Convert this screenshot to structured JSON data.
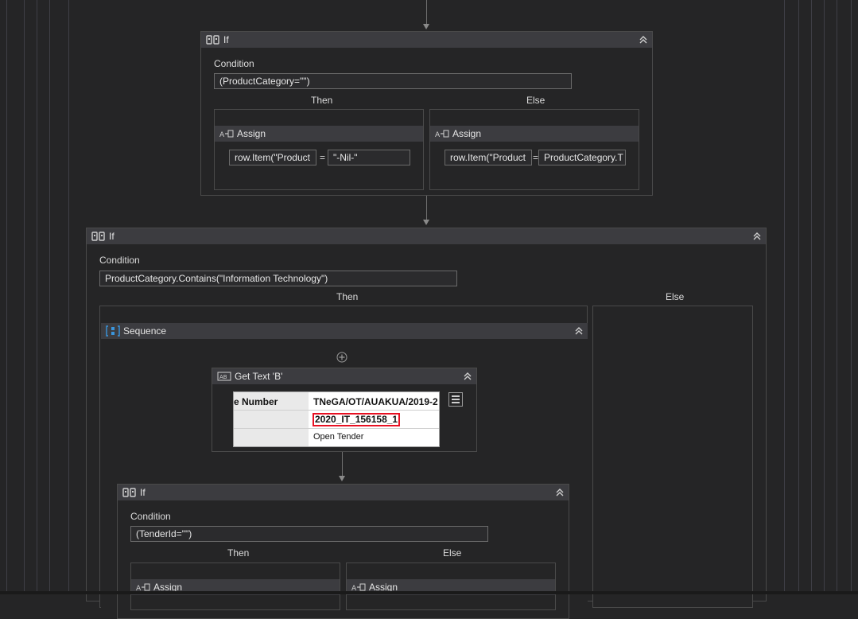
{
  "if1": {
    "title": "If",
    "condition_label": "Condition",
    "condition": "(ProductCategory=\"\")",
    "then_label": "Then",
    "else_label": "Else",
    "then_assign": {
      "title": "Assign",
      "to": "row.Item(\"Product",
      "value": "\"-Nil-\""
    },
    "else_assign": {
      "title": "Assign",
      "to": "row.Item(\"Product",
      "value": "ProductCategory.T"
    }
  },
  "if2": {
    "title": "If",
    "condition_label": "Condition",
    "condition": "ProductCategory.Contains(\"Information Technology\")",
    "then_label": "Then",
    "else_label": "Else"
  },
  "sequence": {
    "title": "Sequence"
  },
  "get_text": {
    "title": "Get Text 'B'",
    "preview": {
      "row1_label": "e Number",
      "row1_value": "TNeGA/OT/AUAKUA/2019-2",
      "row2_value": "2020_IT_156158_1",
      "row3_value": "Open Tender"
    }
  },
  "if3": {
    "title": "If",
    "condition_label": "Condition",
    "condition": "(TenderId=\"\")",
    "then_label": "Then",
    "else_label": "Else",
    "then_assign": {
      "title": "Assign"
    },
    "else_assign": {
      "title": "Assign"
    }
  },
  "equals_sign": "=",
  "colors": {
    "background": "#252526",
    "header": "#3c3c40",
    "highlight": "#e81123",
    "sequence_icon": "#3a96dd"
  }
}
